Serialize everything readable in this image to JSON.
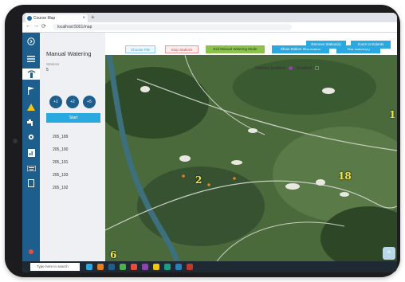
{
  "browser": {
    "tab_title": "Course Map",
    "tab_close": "×",
    "new_tab": "+",
    "back": "←",
    "forward": "→",
    "reload": "⟳",
    "url": "localhost:5001/map"
  },
  "rail": {
    "icons": [
      "chevron-right-icon",
      "menu-icon",
      "sprinkler-icon",
      "flag-icon",
      "warning-icon",
      "tap-icon",
      "gear-icon",
      "report-icon",
      "keyboard-icon",
      "document-icon",
      "power-icon"
    ]
  },
  "panel": {
    "title": "Manual Watering",
    "subtitle": "Stations",
    "count": "5",
    "circle_buttons": [
      "+1",
      "+2",
      "+5"
    ],
    "start_label": "Start",
    "stations": [
      "205_189",
      "205_190",
      "205_191",
      "205_193",
      "205_192"
    ]
  },
  "toolbar": {
    "choose_file": "Choose File",
    "stop_stations": "Stop Stations",
    "exit_manual": "Exit Manual Watering Mode",
    "show_info": "Show Station Information",
    "add_stations": "Add Station(s)",
    "remove_stations": "Remove Station(s)",
    "zoom_to_extents": "Zoom to Extents"
  },
  "legend": {
    "enabled_label": "Stations Enabled",
    "disabled_label": "Disabled"
  },
  "map": {
    "hole_labels": [
      "2",
      "18",
      "6",
      "1"
    ],
    "scroll_top": "^"
  },
  "taskbar": {
    "search_placeholder": "Type here to search"
  },
  "colors": {
    "primary": "#1d5e8c",
    "accent": "#2aa8e0",
    "exit_green": "#8bc34a",
    "hole_label": "#f7e64a"
  }
}
